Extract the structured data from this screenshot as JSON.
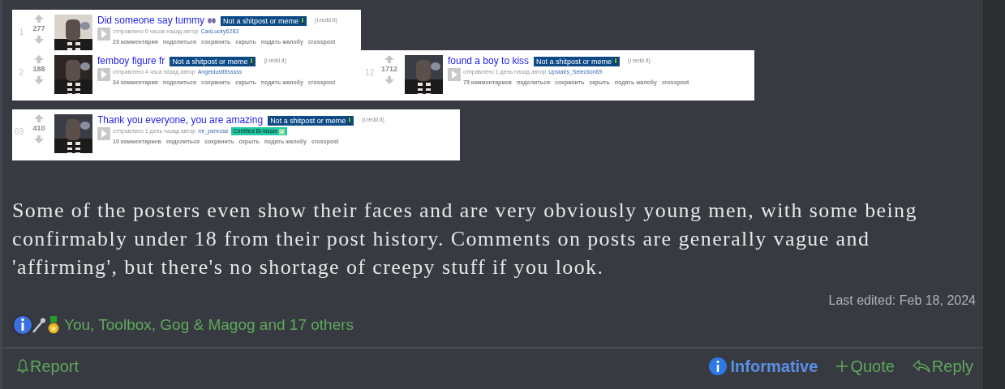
{
  "post": {
    "screenshots": [
      {
        "entries": [
          {
            "rank": "1",
            "score": "277",
            "title": "Did someone say tummy",
            "title_icon": true,
            "flair": "Not a shitpost or meme",
            "domain": "(i.redd.it)",
            "meta": "отправлено 6 часов назад автор",
            "author": "CanLucky6283",
            "links": [
              "23 комментария",
              "поделиться",
              "сохранить",
              "скрыть",
              "подать жалобу",
              "crosspost"
            ]
          }
        ]
      },
      {
        "entries": [
          {
            "rank": "2",
            "score": "188",
            "title": "femboy figure fr",
            "title_icon": false,
            "flair": "Not a shitpost or meme",
            "domain": "(i.redd.it)",
            "meta": "отправлено 4 часа назад автор",
            "author": "Angeldusttttsssss",
            "links": [
              "34 комментария",
              "поделиться",
              "сохранить",
              "скрыть",
              "подать жалобу",
              "crosspost"
            ]
          },
          {
            "rank": "12",
            "score": "1712",
            "title": "found a boy to kiss",
            "title_icon": false,
            "flair": "Not a shitpost or meme",
            "domain": "(i.redd.it)",
            "meta": "отправлено 1 день назад автор",
            "author": "Upstairs_Selection69",
            "links": [
              "75 комментариев",
              "поделиться",
              "сохранить",
              "скрыть",
              "подать жалобу",
              "crosspost"
            ]
          }
        ]
      },
      {
        "entries": [
          {
            "rank": "69",
            "score": "410",
            "title": "Thank you everyone, you are amazing",
            "title_icon": false,
            "flair": "Not a shitpost or meme",
            "domain": "(i.redd.it)",
            "meta": "отправлено 1 день назад автор",
            "author": "mr_penrose",
            "user_flair": "Certified Bi-kisser",
            "links": [
              "10 комментариев",
              "поделиться",
              "сохранить",
              "скрыть",
              "подать жалобу",
              "crosspost"
            ]
          }
        ]
      }
    ],
    "body": "Some of the posters even show their faces and are very obviously young men, with some being confirmably under 18 from their post history. Comments on posts are generally vague and 'affirming', but there's no shortage of creepy stuff if you look.",
    "last_edited": "Last edited: Feb 18, 2024",
    "reactions": {
      "summary": "You, Toolbox, Gog & Magog and 17 others"
    },
    "actions": [
      {
        "kind": "report",
        "label": "Report"
      },
      {
        "kind": "reaction",
        "label": "Informative",
        "selected": true
      },
      {
        "kind": "quote",
        "label": "Quote"
      },
      {
        "kind": "reply",
        "label": "Reply"
      }
    ]
  }
}
